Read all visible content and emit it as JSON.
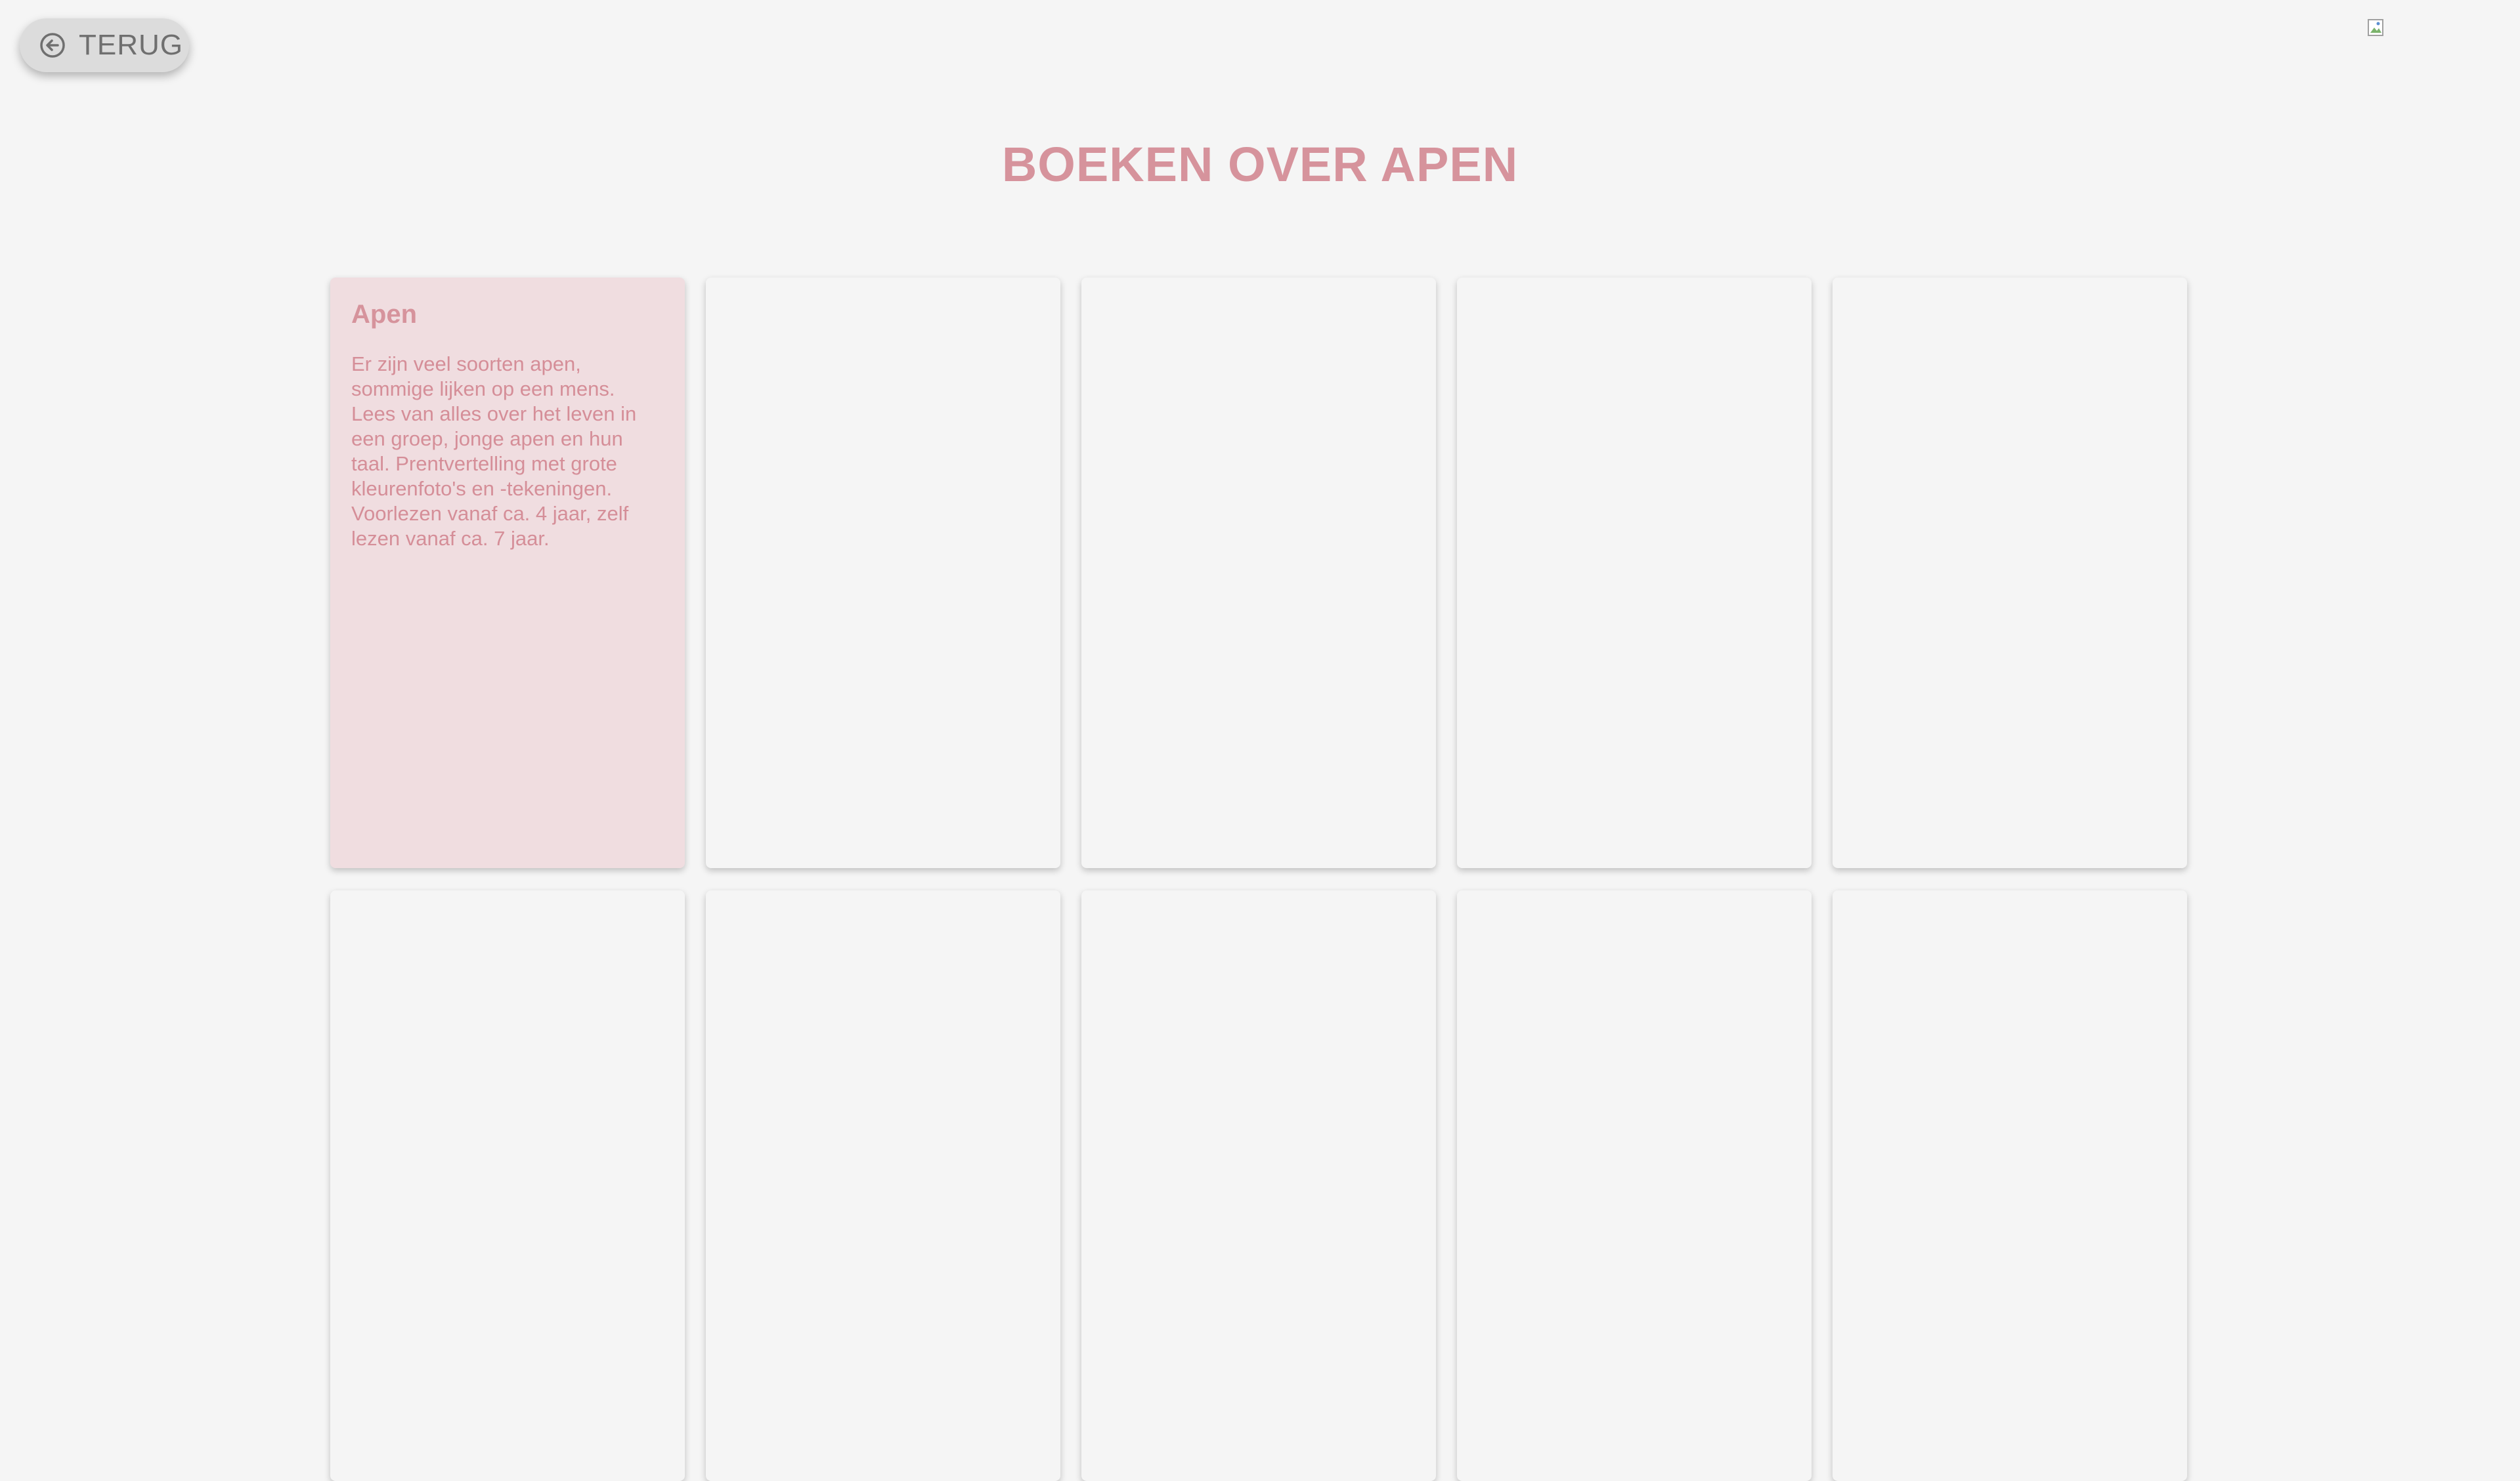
{
  "header": {
    "back_label": "TERUG"
  },
  "icons": {
    "back": "arrow-left-circle-icon",
    "broken_image": "broken-image-icon"
  },
  "page": {
    "title": "BOEKEN OVER APEN"
  },
  "cards": [
    {
      "title": "Apen",
      "text": "Er zijn veel soorten apen, sommige lijken op een mens. Lees van alles over het leven in een groep, jonge apen en hun taal. Prentvertelling met grote kleurenfoto's en -tekeningen. Voorlezen vanaf ca. 4 jaar, zelf lezen vanaf ca. 7 jaar."
    }
  ],
  "colors": {
    "background": "#f5f5f5",
    "accent": "#d6939c",
    "featured_card": "#f0dde0",
    "back_button": "#dcdcdc",
    "back_text": "#6f6f6f"
  }
}
